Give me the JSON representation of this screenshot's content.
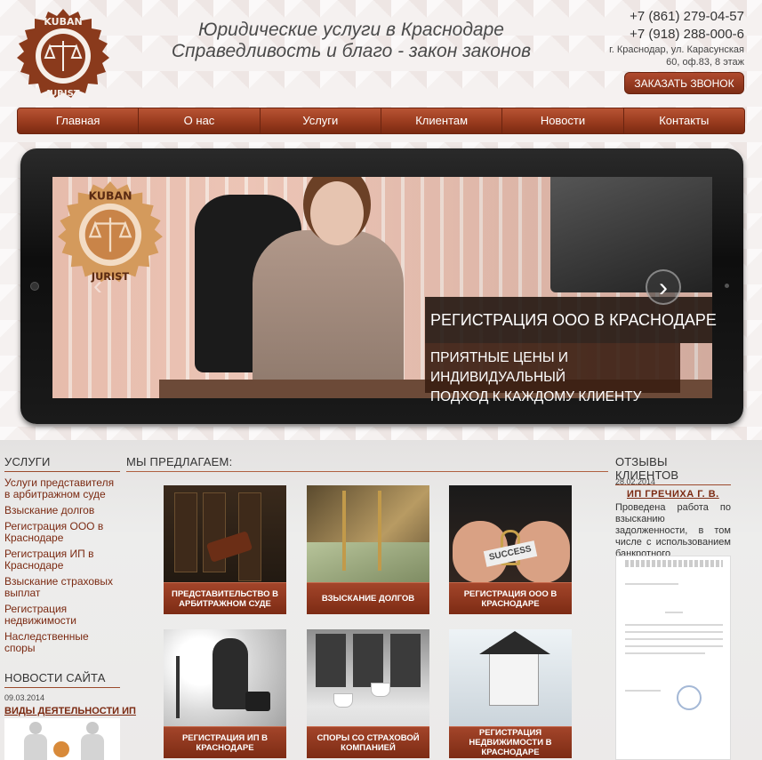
{
  "header": {
    "logo_top": "KUBAN",
    "logo_bottom": "JURIST",
    "slogan_line1": "Юридические услуги в Краснодаре",
    "slogan_line2": "Справедливость и благо - закон законов",
    "phone1": "+7 (861) 279-04-57",
    "phone2": "+7 (918) 288-000-6",
    "address_line1": "г. Краснодар, ул. Карасунская",
    "address_line2": "60, оф.83, 8 этаж",
    "call_button": "ЗАКАЗАТЬ ЗВОНОК"
  },
  "nav": {
    "items": [
      "Главная",
      "О нас",
      "Услуги",
      "Клиентам",
      "Новости",
      "Контакты"
    ]
  },
  "slider": {
    "logo_top": "KUBAN",
    "logo_bottom": "JURIST",
    "title": "РЕГИСТРАЦИЯ ООО В КРАСНОДАРЕ",
    "subtitle_line1": "ПРИЯТНЫЕ ЦЕНЫ И ИНДИВИДУАЛЬНЫЙ",
    "subtitle_line2": "ПОДХОД К КАЖДОМУ КЛИЕНТУ",
    "prev_glyph": "‹",
    "next_glyph": "›"
  },
  "services": {
    "title": "УСЛУГИ",
    "items": [
      "Услуги представителя в арбитражном суде",
      "Взыскание долгов",
      "Регистрация ООО в Краснодаре",
      "Регистрация ИП в Краснодаре",
      "Взыскание страховых выплат",
      "Регистрация недвижимости",
      "Наследственные споры"
    ]
  },
  "news": {
    "title": "НОВОСТИ САЙТА",
    "date": "09.03.2014",
    "link": "ВИДЫ ДЕЯТЕЛЬНОСТИ ИП"
  },
  "offer": {
    "title": "МЫ ПРЕДЛАГАЕМ:",
    "tiles": [
      "ПРЕДСТАВИТЕЛЬСТВО В АРБИТРАЖНОМ СУДЕ",
      "ВЗЫСКАНИЕ ДОЛГОВ",
      "РЕГИСТРАЦИЯ ООО В КРАСНОДАРЕ",
      "РЕГИСТРАЦИЯ ИП В КРАСНОДАРЕ",
      "СПОРЫ СО СТРАХОВОЙ КОМПАНИЕЙ",
      "РЕГИСТРАЦИЯ НЕДВИЖИМОСТИ В КРАСНОДАРЕ"
    ],
    "tile_text": {
      "success": "SUCCESS"
    }
  },
  "reviews": {
    "title": "ОТЗЫВЫ КЛИЕНТОВ",
    "date": "28.02.2014",
    "name": "ИП ГРЕЧИХА Г. В.",
    "text": "Проведена работа по взысканию задолженности, в том числе с использованием банкротного производства."
  },
  "colors": {
    "brand": "#7b2a12",
    "nav_top": "#b85434",
    "nav_bottom": "#7b2a12",
    "caption_bg": "#1e120c"
  }
}
